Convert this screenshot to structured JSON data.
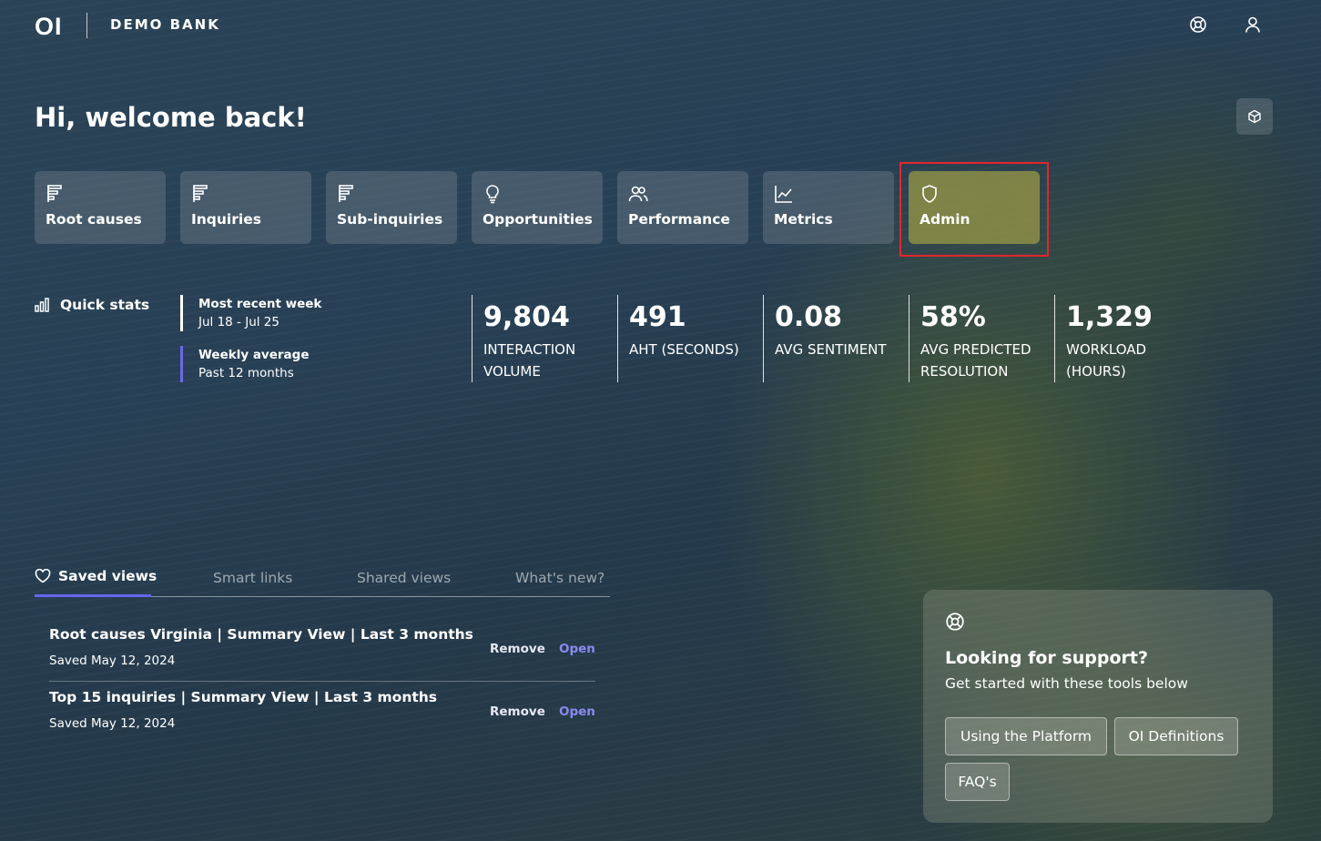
{
  "header": {
    "logo": "OI",
    "org_name": "DEMO BANK",
    "icons": [
      "support-wheel-icon",
      "user-icon"
    ]
  },
  "welcome": "Hi, welcome back!",
  "nav": [
    {
      "label": "Root causes",
      "icon": "list-icon"
    },
    {
      "label": "Inquiries",
      "icon": "list-icon"
    },
    {
      "label": "Sub-inquiries",
      "icon": "list-icon"
    },
    {
      "label": "Opportunities",
      "icon": "lightbulb-icon"
    },
    {
      "label": "Performance",
      "icon": "people-icon"
    },
    {
      "label": "Metrics",
      "icon": "line-chart-icon"
    },
    {
      "label": "Admin",
      "icon": "shield-icon",
      "active": true
    }
  ],
  "quick_stats": {
    "title": "Quick stats",
    "most_recent": {
      "label": "Most recent week",
      "range": "Jul 18 - Jul 25"
    },
    "weekly_avg": {
      "label": "Weekly average",
      "range": "Past 12 months"
    },
    "stats": [
      {
        "value": "9,804",
        "label_1": "Interaction",
        "label_2": "Volume"
      },
      {
        "value": "491",
        "label_1": "AHT (Seconds)",
        "label_2": ""
      },
      {
        "value": "0.08",
        "label_1": "Avg Sentiment",
        "label_2": ""
      },
      {
        "value": "58%",
        "label_1": "Avg Predicted",
        "label_2": "Resolution"
      },
      {
        "value": "1,329",
        "label_1": "Workload",
        "label_2": "(Hours)"
      }
    ]
  },
  "tabs": [
    "Saved views",
    "Smart links",
    "Shared views",
    "What's new?"
  ],
  "saved_views": [
    {
      "title": "Root causes Virginia | Summary View | Last 3 months",
      "date": "Saved May 12, 2024",
      "remove": "Remove",
      "open": "Open"
    },
    {
      "title": "Top 15 inquiries | Summary View | Last 3 months",
      "date": "Saved May 12, 2024",
      "remove": "Remove",
      "open": "Open"
    }
  ],
  "support": {
    "title": "Looking for support?",
    "subtitle": "Get started with these tools below",
    "buttons": [
      "Using the Platform",
      "OI Definitions",
      "FAQ's"
    ]
  },
  "colors": {
    "accent": "#6666ee",
    "active_card": "#91913f",
    "highlight": "#e3262a"
  }
}
